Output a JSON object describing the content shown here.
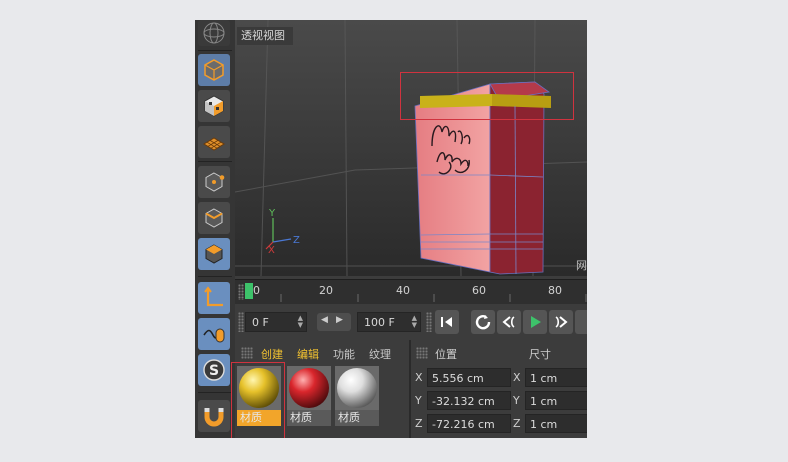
{
  "viewport": {
    "title": "透视视图",
    "corner_text": "网"
  },
  "timeline": {
    "ticks": [
      "0",
      "20",
      "40",
      "60",
      "80"
    ]
  },
  "transport": {
    "start_frame": "0 F",
    "end_frame": "100 F"
  },
  "material_manager": {
    "menu": [
      "创建",
      "编辑",
      "功能",
      "纹理"
    ],
    "materials": [
      {
        "label": "材质",
        "color": "#e6c12a"
      },
      {
        "label": "材质",
        "color": "#d9262c"
      },
      {
        "label": "材质",
        "color": "#e0e0e0"
      }
    ]
  },
  "coordinates": {
    "position_header": "位置",
    "size_header": "尺寸",
    "rows": [
      {
        "axis": "X",
        "position": "5.556 cm",
        "size_axis": "X",
        "size": "1 cm"
      },
      {
        "axis": "Y",
        "position": "-32.132 cm",
        "size_axis": "Y",
        "size": "1 cm"
      },
      {
        "axis": "Z",
        "position": "-72.216 cm",
        "size_axis": "Z",
        "size": "1 cm"
      }
    ]
  },
  "icons": [
    "sphere-grid-icon",
    "cube-mode-icon",
    "checker-cube-icon",
    "grid-plane-icon",
    "point-mode-icon",
    "edge-mode-icon",
    "poly-mode-icon",
    "axis-icon",
    "sculpt-mouse-icon",
    "snap-s-icon",
    "magnet-icon"
  ],
  "colors": {
    "accent": "#f2a52a",
    "selection": "#d0333f",
    "box_red": "#8b2330",
    "box_pink": "#e88a8c",
    "gold_band": "#c9b21a"
  }
}
